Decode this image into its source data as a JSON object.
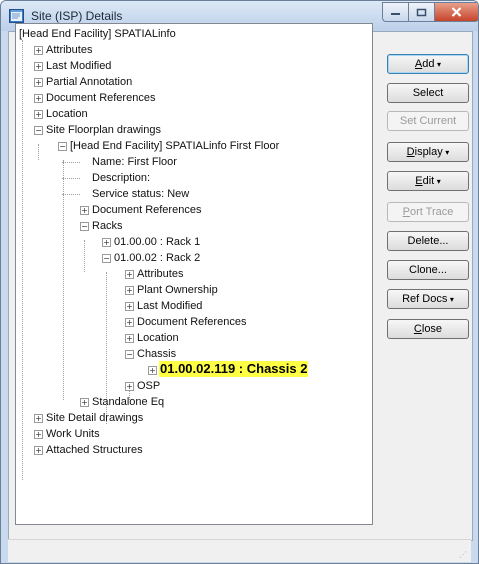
{
  "window": {
    "title": "Site (ISP) Details"
  },
  "tree": [
    {
      "label": "[Head End Facility] SPATIALinfo",
      "level": 0,
      "exp": "",
      "hl": false
    },
    {
      "label": "Attributes",
      "level": 1,
      "exp": "+",
      "hl": false
    },
    {
      "label": "Last Modified",
      "level": 1,
      "exp": "+",
      "hl": false
    },
    {
      "label": "Partial Annotation",
      "level": 1,
      "exp": "+",
      "hl": false
    },
    {
      "label": "Document References",
      "level": 1,
      "exp": "+",
      "hl": false
    },
    {
      "label": "Location",
      "level": 1,
      "exp": "+",
      "hl": false
    },
    {
      "label": "Site Floorplan drawings",
      "level": 1,
      "exp": "-",
      "hl": false
    },
    {
      "label": "[Head End Facility] SPATIALinfo First Floor",
      "level": 2,
      "exp": "-",
      "hl": false
    },
    {
      "label": "Name: First Floor",
      "level": 3,
      "exp": "",
      "hl": false
    },
    {
      "label": "Description:",
      "level": 3,
      "exp": "",
      "hl": false
    },
    {
      "label": "Service status: New",
      "level": 3,
      "exp": "",
      "hl": false
    },
    {
      "label": "Document References",
      "level": 3,
      "exp": "+",
      "hl": false
    },
    {
      "label": "Racks",
      "level": 3,
      "exp": "-",
      "hl": false
    },
    {
      "label": "01.00.00 : Rack 1",
      "level": 4,
      "exp": "+",
      "hl": false
    },
    {
      "label": "01.00.02 : Rack 2",
      "level": 4,
      "exp": "-",
      "hl": false
    },
    {
      "label": "Attributes",
      "level": 5,
      "exp": "+",
      "hl": false
    },
    {
      "label": "Plant Ownership",
      "level": 5,
      "exp": "+",
      "hl": false
    },
    {
      "label": "Last Modified",
      "level": 5,
      "exp": "+",
      "hl": false
    },
    {
      "label": "Document References",
      "level": 5,
      "exp": "+",
      "hl": false
    },
    {
      "label": "Location",
      "level": 5,
      "exp": "+",
      "hl": false
    },
    {
      "label": "Chassis",
      "level": 5,
      "exp": "-",
      "hl": false
    },
    {
      "label": "01.00.02.119 : Chassis 2",
      "level": 6,
      "exp": "+",
      "hl": true
    },
    {
      "label": "OSP",
      "level": 5,
      "exp": "+",
      "hl": false
    },
    {
      "label": "Standalone Eq",
      "level": 3,
      "exp": "+",
      "hl": false
    },
    {
      "label": "Site Detail drawings",
      "level": 1,
      "exp": "+",
      "hl": false
    },
    {
      "label": "Work Units",
      "level": 1,
      "exp": "+",
      "hl": false
    },
    {
      "label": "Attached Structures",
      "level": 1,
      "exp": "+",
      "hl": false
    }
  ],
  "buttons": [
    {
      "label": "Add",
      "mnemonic": "A",
      "dropdown": true,
      "disabled": false,
      "default": true
    },
    {
      "label": "Select",
      "mnemonic": "",
      "dropdown": false,
      "disabled": false,
      "default": false
    },
    {
      "label": "Set Current",
      "mnemonic": "",
      "dropdown": false,
      "disabled": true,
      "default": false
    },
    {
      "label": "Display",
      "mnemonic": "D",
      "dropdown": true,
      "disabled": false,
      "default": false
    },
    {
      "label": "Edit",
      "mnemonic": "E",
      "dropdown": true,
      "disabled": false,
      "default": false
    },
    {
      "label": "Port Trace",
      "mnemonic": "P",
      "dropdown": false,
      "disabled": true,
      "default": false
    },
    {
      "label": "Delete...",
      "mnemonic": "",
      "dropdown": false,
      "disabled": false,
      "default": false
    },
    {
      "label": "Clone...",
      "mnemonic": "",
      "dropdown": false,
      "disabled": false,
      "default": false
    },
    {
      "label": "Ref Docs",
      "mnemonic": "",
      "dropdown": true,
      "disabled": false,
      "default": false
    },
    {
      "label": "Close",
      "mnemonic": "C",
      "dropdown": false,
      "disabled": false,
      "default": false
    }
  ]
}
